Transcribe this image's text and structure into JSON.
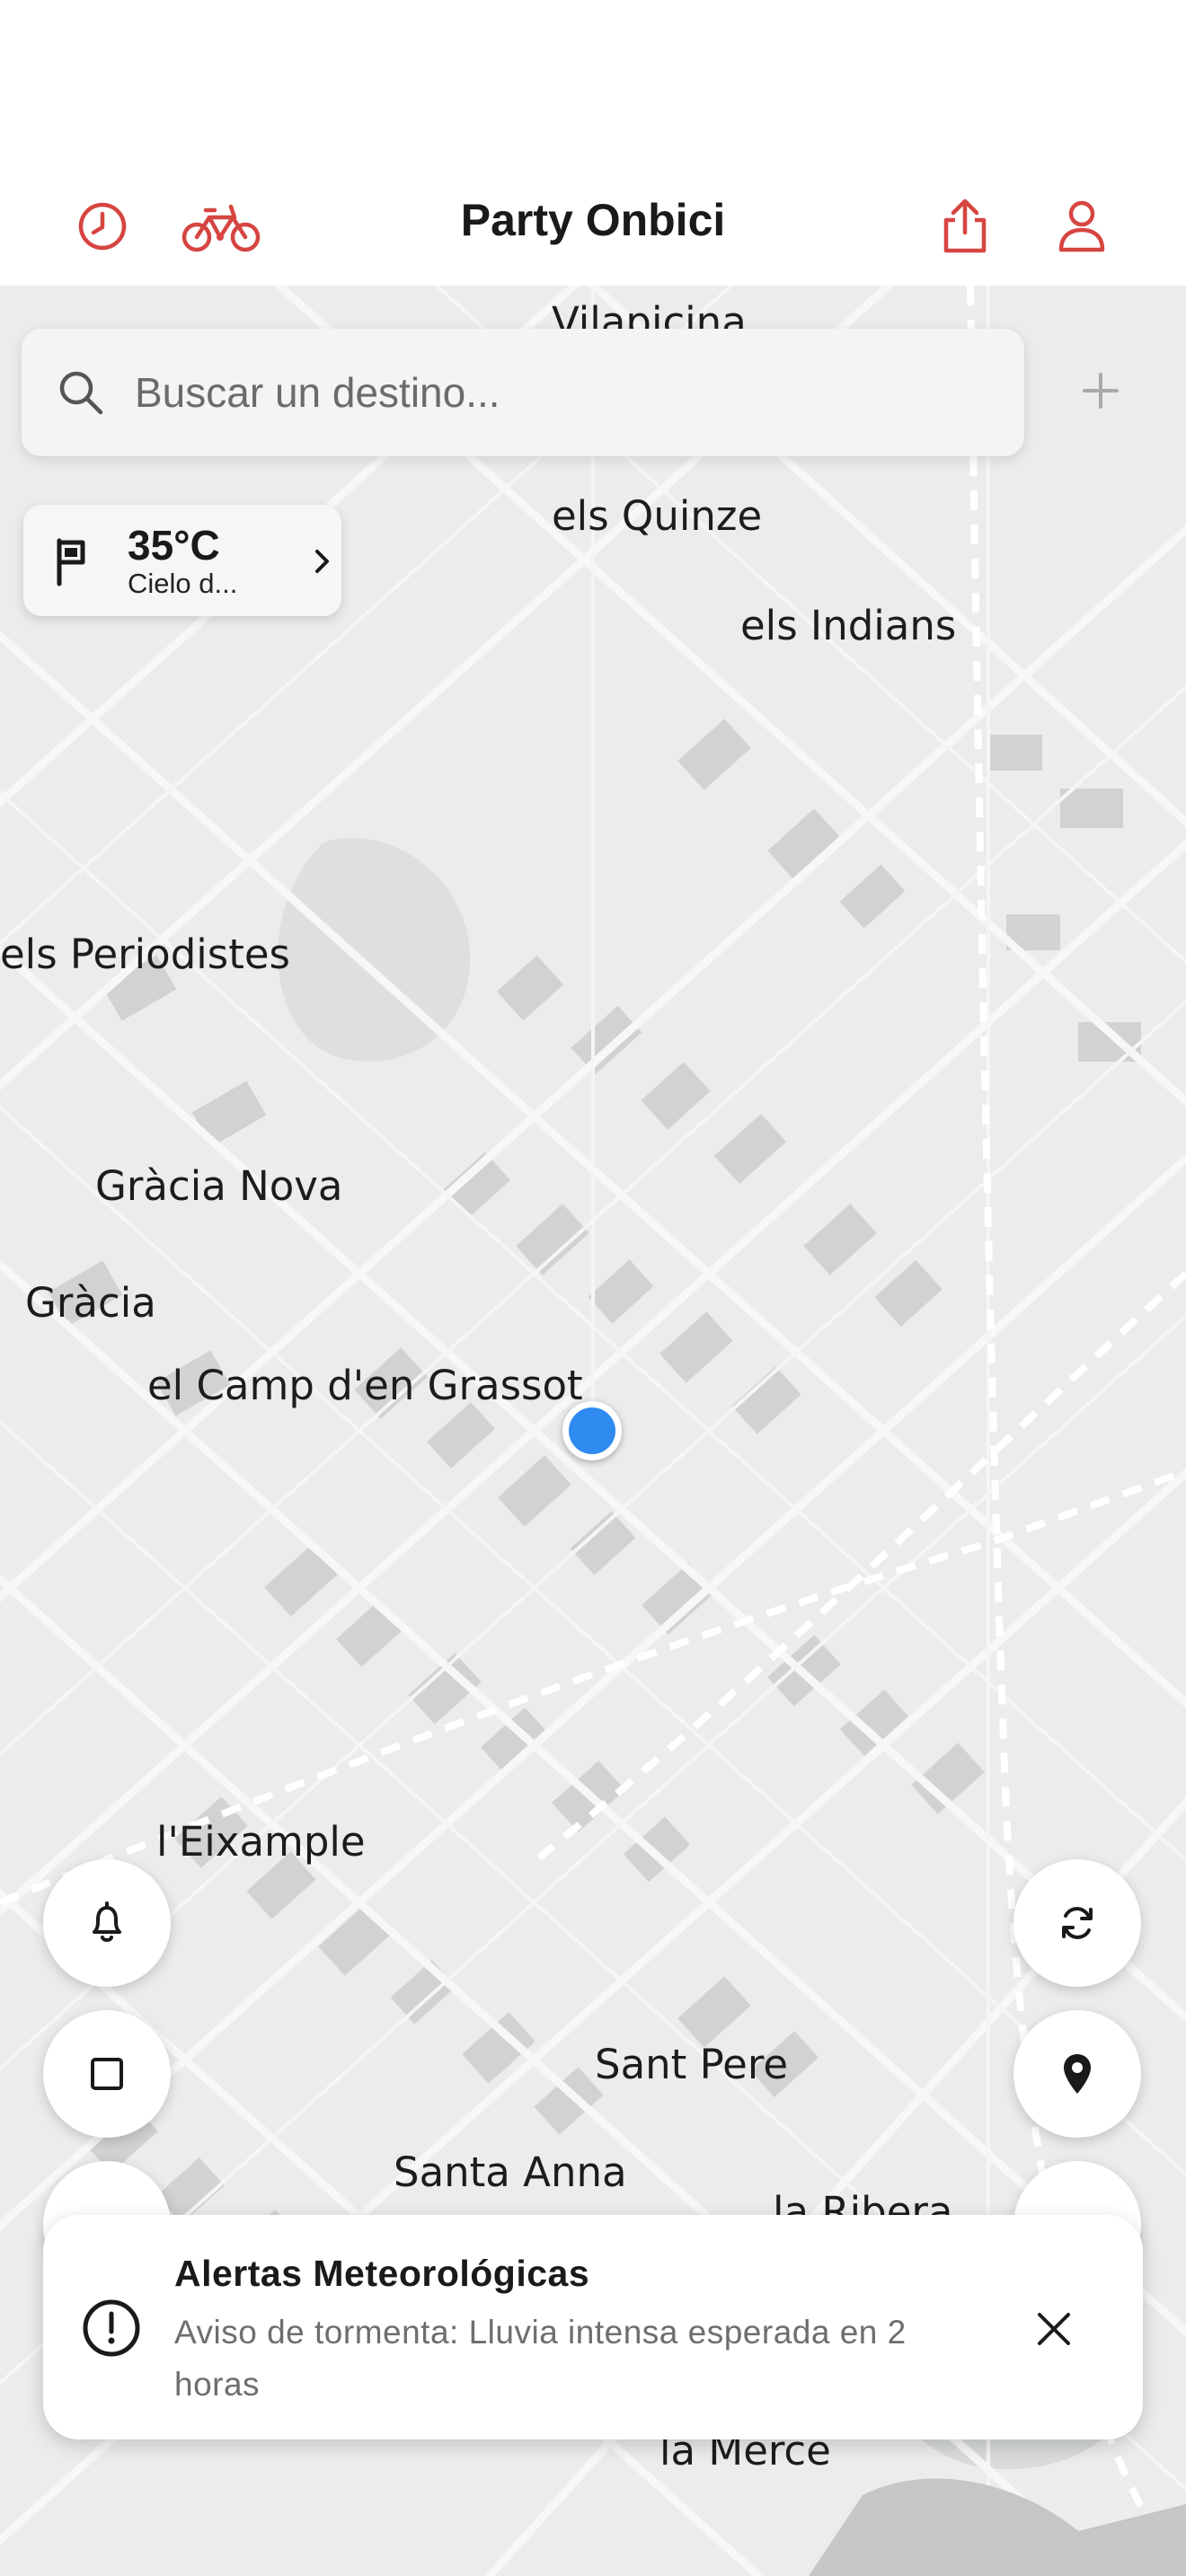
{
  "header": {
    "title": "Party Onbici",
    "icons": [
      "history-icon",
      "bicycle-icon",
      "share-icon",
      "profile-icon"
    ]
  },
  "search": {
    "placeholder": "Buscar un destino..."
  },
  "weather": {
    "temperature": "35°C",
    "description": "Cielo d..."
  },
  "map": {
    "labels": {
      "vilapicina": "Vilapicina",
      "els_quinze": "els Quinze",
      "els_indians": "els Indians",
      "els_periodistes": "els Periodistes",
      "gracia_nova": "Gràcia Nova",
      "gracia": "Gràcia",
      "camp_grassot": "el Camp d'en Grassot",
      "eixample": "l'Eixample",
      "sant_pere": "Sant Pere",
      "santa_anna": "Santa Anna",
      "la_ribera": "la Ribera",
      "la_merce": "la Mercè"
    }
  },
  "alert": {
    "title": "Alertas Meteorológicas",
    "message": "Aviso de tormenta: Lluvia intensa esperada en 2 horas"
  },
  "colors": {
    "accent": "#d64541",
    "location_dot": "#2f8bf0",
    "map_background": "#ececec"
  }
}
